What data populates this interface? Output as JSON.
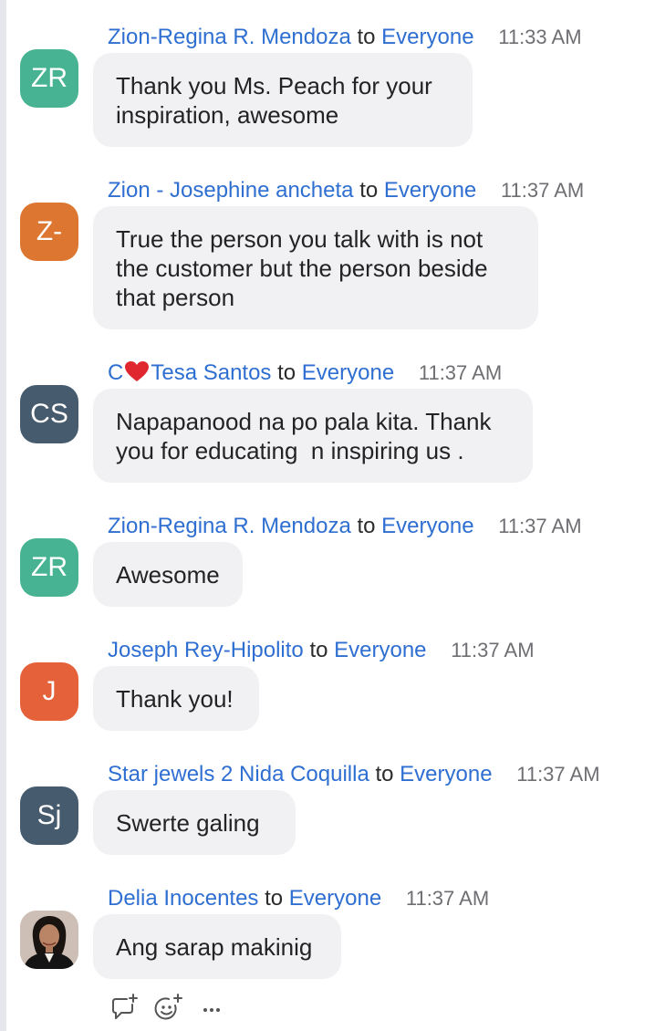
{
  "messages": [
    {
      "sender": "Zion-Regina R. Mendoza",
      "to_word": "to",
      "recipient": "Everyone",
      "time": "11:33 AM",
      "avatar_initials": "ZR",
      "avatar_color": "#47b392",
      "text": "Thank you Ms. Peach for your\ninspiration, awesome"
    },
    {
      "sender": "Zion - Josephine ancheta",
      "to_word": "to",
      "recipient": "Everyone",
      "time": "11:37 AM",
      "avatar_initials": "Z-",
      "avatar_color": "#dd7630",
      "text": "True the person you talk with is not\nthe customer but the person beside\nthat person"
    },
    {
      "sender_prefix": "C",
      "sender_emoji": "heart-emoji",
      "sender": "Tesa Santos",
      "to_word": "to",
      "recipient": "Everyone",
      "time": "11:37 AM",
      "avatar_initials": "CS",
      "avatar_color": "#465b6e",
      "text": "Napapanood na po pala kita. Thank\nyou for educating  n inspiring us ."
    },
    {
      "sender": "Zion-Regina R. Mendoza",
      "to_word": "to",
      "recipient": "Everyone",
      "time": "11:37 AM",
      "avatar_initials": "ZR",
      "avatar_color": "#47b392",
      "text": "Awesome"
    },
    {
      "sender": "Joseph Rey-Hipolito",
      "to_word": "to",
      "recipient": "Everyone",
      "time": "11:37 AM",
      "avatar_initials": "J",
      "avatar_color": "#e4613a",
      "text": "Thank you!"
    },
    {
      "sender": "Star jewels 2 Nida Coquilla",
      "to_word": "to",
      "recipient": "Everyone",
      "time": "11:37 AM",
      "avatar_initials": "Sj",
      "avatar_color": "#465b6e",
      "text": "Swerte galing"
    },
    {
      "sender": "Delia Inocentes",
      "to_word": "to",
      "recipient": "Everyone",
      "time": "11:37 AM",
      "avatar_initials": "",
      "avatar_photo": "profile-photo",
      "text": "Ang sarap makinig"
    }
  ],
  "actions": [
    {
      "icon": "reply-icon"
    },
    {
      "icon": "add-reaction-icon"
    },
    {
      "icon": "more-options-icon"
    }
  ],
  "colors": {
    "link_blue": "#2f6fd1",
    "bubble_bg": "#f1f1f4",
    "timestamp_gray": "#6f6f73"
  }
}
